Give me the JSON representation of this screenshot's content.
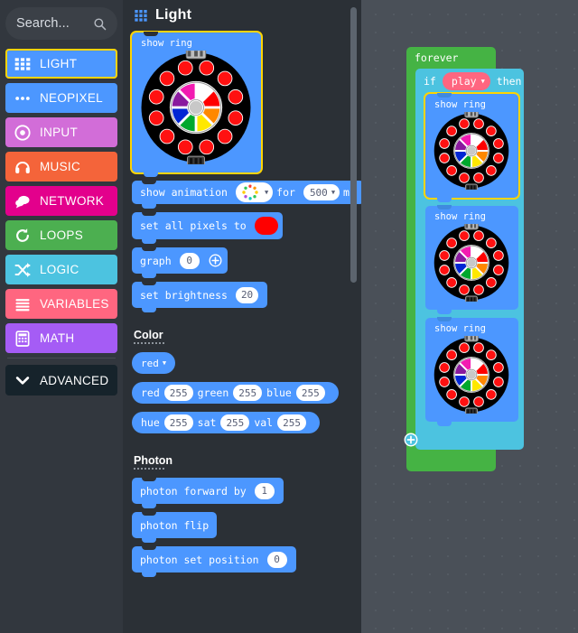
{
  "search": {
    "placeholder": "Search...",
    "icon": "search-icon"
  },
  "sidebar": {
    "categories": [
      {
        "label": "LIGHT",
        "color": "#4c97ff",
        "icon": "grid-icon",
        "selected": true
      },
      {
        "label": "NEOPIXEL",
        "color": "#4c97ff",
        "icon": "dots-icon",
        "selected": false
      },
      {
        "label": "INPUT",
        "color": "#d26dd8",
        "icon": "target-icon",
        "selected": false
      },
      {
        "label": "MUSIC",
        "color": "#f4643a",
        "icon": "headphone-icon",
        "selected": false
      },
      {
        "label": "NETWORK",
        "color": "#e3008c",
        "icon": "chat-icon",
        "selected": false
      },
      {
        "label": "LOOPS",
        "color": "#4caf50",
        "icon": "refresh-icon",
        "selected": false
      },
      {
        "label": "LOGIC",
        "color": "#4cc3e0",
        "icon": "shuffle-icon",
        "selected": false
      },
      {
        "label": "VARIABLES",
        "color": "#ff6680",
        "icon": "lines-icon",
        "selected": false
      },
      {
        "label": "MATH",
        "color": "#a55cf5",
        "icon": "calculator-icon",
        "selected": false
      }
    ],
    "advanced": {
      "label": "ADVANCED",
      "icon": "chevron-down-icon"
    }
  },
  "flyout": {
    "title": "Light",
    "icon": "grid-icon",
    "blocks": {
      "show_ring": {
        "title": "show ring",
        "selected": true
      },
      "show_animation": {
        "label_1": "show animation",
        "animation_value": "rainbow-animation-icon",
        "label_2": "for",
        "duration": "500",
        "label_3": "ms"
      },
      "set_all_pixels": {
        "label": "set all pixels to",
        "color": "#ff0000"
      },
      "graph": {
        "label": "graph",
        "value": "0",
        "plus": "plus-icon"
      },
      "set_brightness": {
        "label": "set brightness",
        "value": "20"
      }
    },
    "groups": [
      {
        "name": "Color"
      },
      {
        "name": "Photon"
      }
    ],
    "color_blocks": {
      "named_color": {
        "value": "red"
      },
      "rgb": {
        "label_r": "red",
        "value_r": "255",
        "label_g": "green",
        "value_g": "255",
        "label_b": "blue",
        "value_b": "255"
      },
      "hsv": {
        "label_h": "hue",
        "value_h": "255",
        "label_s": "sat",
        "value_s": "255",
        "label_v": "val",
        "value_v": "255"
      }
    },
    "photon_blocks": {
      "forward": {
        "label": "photon forward by",
        "value": "1"
      },
      "flip": {
        "label": "photon flip"
      },
      "set_position": {
        "label": "photon set position",
        "value": "0"
      }
    }
  },
  "workspace": {
    "forever": {
      "label": "forever"
    },
    "if_block": {
      "label_if": "if",
      "condition": "play",
      "label_then": "then",
      "plus": "plus-icon"
    },
    "ring_blocks": [
      {
        "title": "show ring",
        "selected": true
      },
      {
        "title": "show ring",
        "selected": false
      },
      {
        "title": "show ring",
        "selected": false
      }
    ]
  },
  "ring_graphic": {
    "outer_led_count": 12,
    "outer_led_color": "#ff1111",
    "board_color": "#000000",
    "hub_color": "#c8c8c8",
    "wheel_segments": [
      {
        "name": "white",
        "color": "#ffffff"
      },
      {
        "name": "red",
        "color": "#ff0000"
      },
      {
        "name": "orange",
        "color": "#ff8800"
      },
      {
        "name": "yellow",
        "color": "#ffe800"
      },
      {
        "name": "green",
        "color": "#00a82d"
      },
      {
        "name": "blue",
        "color": "#0026d4"
      },
      {
        "name": "purple",
        "color": "#8a1a9e"
      },
      {
        "name": "magenta",
        "color": "#f21bb1"
      }
    ]
  }
}
